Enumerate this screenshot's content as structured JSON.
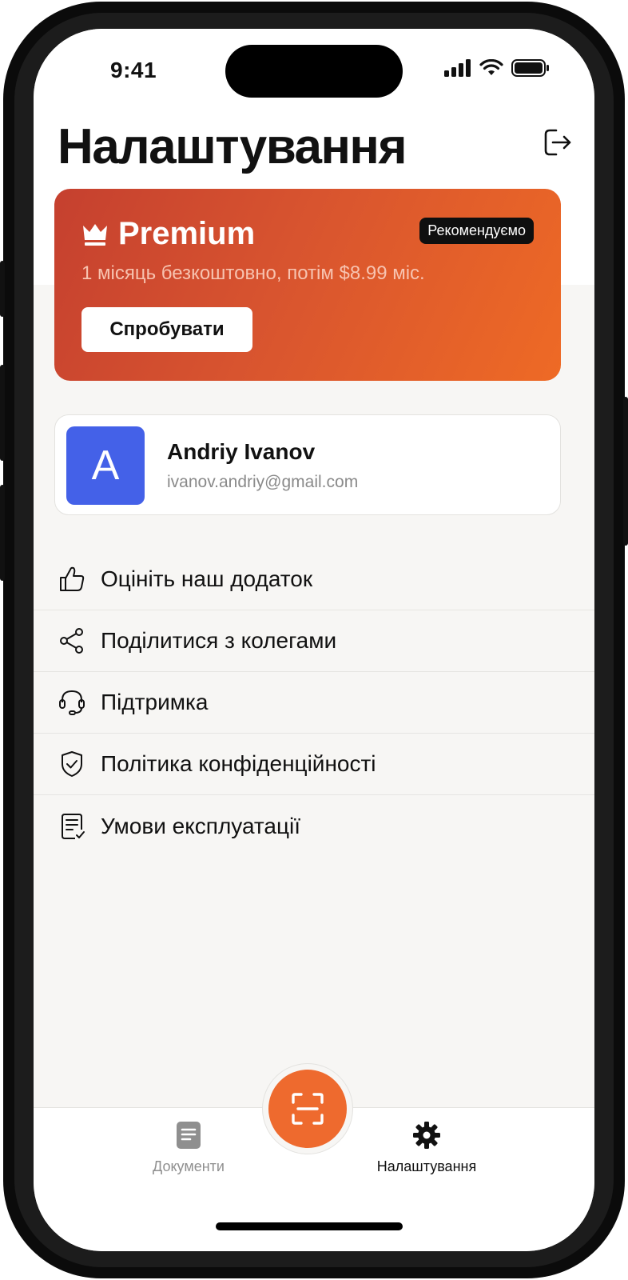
{
  "status_bar": {
    "time": "9:41"
  },
  "header": {
    "title": "Налаштування",
    "logout_icon": "logout-icon"
  },
  "premium": {
    "title": "Premium",
    "badge": "Рекомендуємо",
    "subtitle": "1 місяць безкоштовно, потім $8.99 міс.",
    "button": "Спробувати",
    "colors": {
      "gradient_start": "#c5402f",
      "gradient_end": "#ee6a25"
    }
  },
  "profile": {
    "initial": "A",
    "name": "Andriy Ivanov",
    "email": "ivanov.andriy@gmail.com",
    "avatar_color": "#4461e8"
  },
  "menu": {
    "items": [
      {
        "label": "Оцініть наш додаток",
        "icon": "thumbs-up-icon"
      },
      {
        "label": "Поділитися з колегами",
        "icon": "share-icon"
      },
      {
        "label": "Підтримка",
        "icon": "headset-icon"
      },
      {
        "label": "Політика конфіденційності",
        "icon": "shield-check-icon"
      },
      {
        "label": "Умови експлуатації",
        "icon": "document-check-icon"
      }
    ]
  },
  "tabbar": {
    "documents": "Документи",
    "settings": "Налаштування",
    "scan_icon": "scan-icon",
    "accent": "#ee6a2e"
  }
}
